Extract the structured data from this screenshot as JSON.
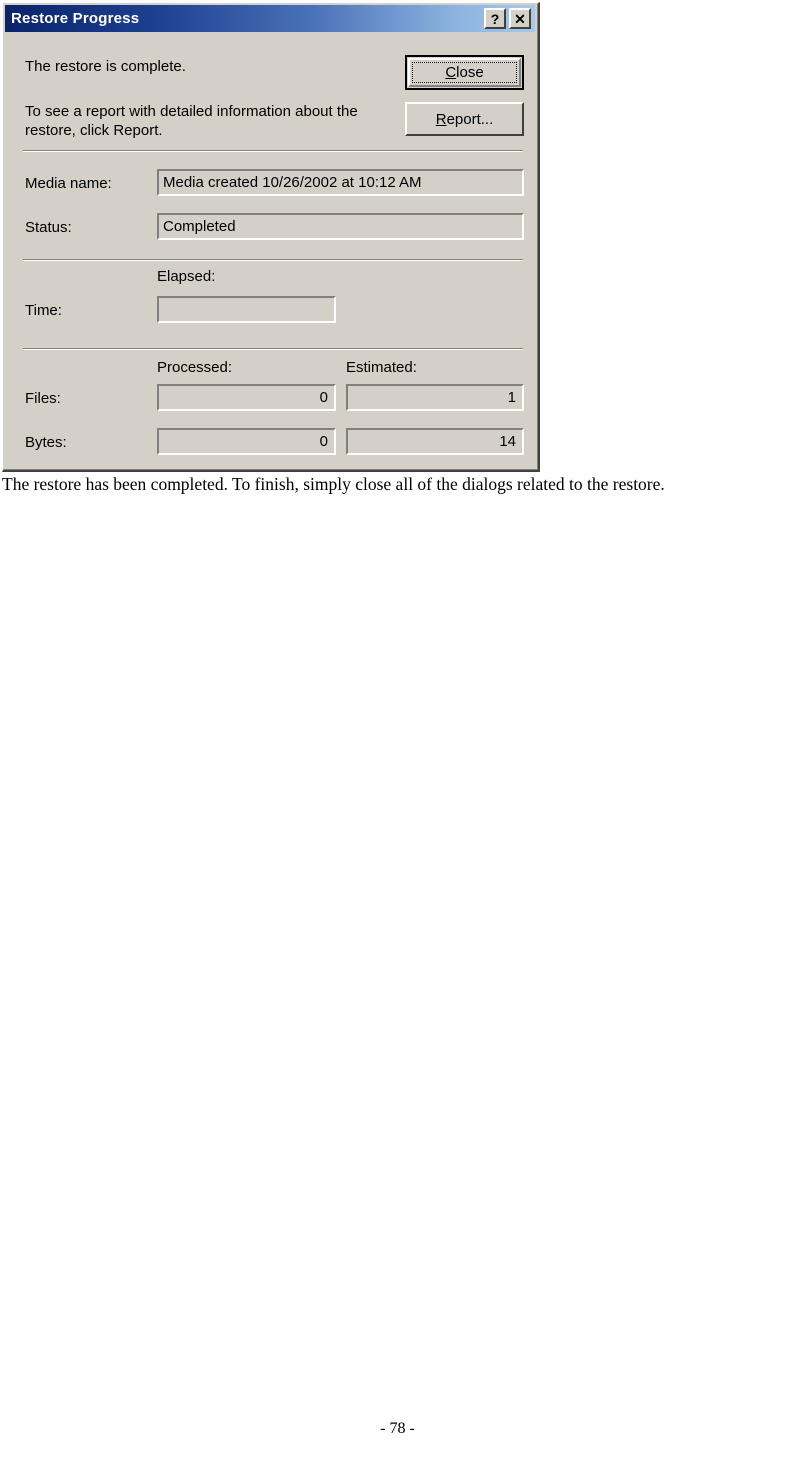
{
  "dialog": {
    "title": "Restore Progress",
    "titlebar_buttons": [
      {
        "name": "help-button",
        "glyph": "?"
      },
      {
        "name": "close-button",
        "glyph": "✕"
      }
    ],
    "messages": {
      "complete": "The restore is complete.",
      "report_hint": "To see a report with detailed information about the restore, click Report."
    },
    "buttons": {
      "close": {
        "prefix": "",
        "accel": "C",
        "suffix": "lose"
      },
      "report": {
        "prefix": "",
        "accel": "R",
        "suffix": "eport..."
      }
    },
    "fields": {
      "media_name": {
        "label": "Media name:",
        "value": "Media created 10/26/2002 at 10:12 AM"
      },
      "status": {
        "label": "Status:",
        "value": "Completed"
      }
    },
    "time": {
      "label": "Time:",
      "elapsed_header": "Elapsed:",
      "elapsed_value": ""
    },
    "counters": {
      "processed_header": "Processed:",
      "estimated_header": "Estimated:",
      "rows": [
        {
          "label": "Files:",
          "processed": "0",
          "estimated": "1"
        },
        {
          "label": "Bytes:",
          "processed": "0",
          "estimated": "14"
        }
      ]
    },
    "colors": {
      "face": "#d4d0c8",
      "title_gradient_start": "#0a246a",
      "title_gradient_end": "#a8c9ec",
      "shadow": "#808080",
      "highlight": "#ffffff",
      "text": "#000000"
    }
  },
  "page": {
    "caption": "The restore has been completed.  To finish, simply close all of the dialogs related to the restore.",
    "page_number": "- 78 -"
  }
}
